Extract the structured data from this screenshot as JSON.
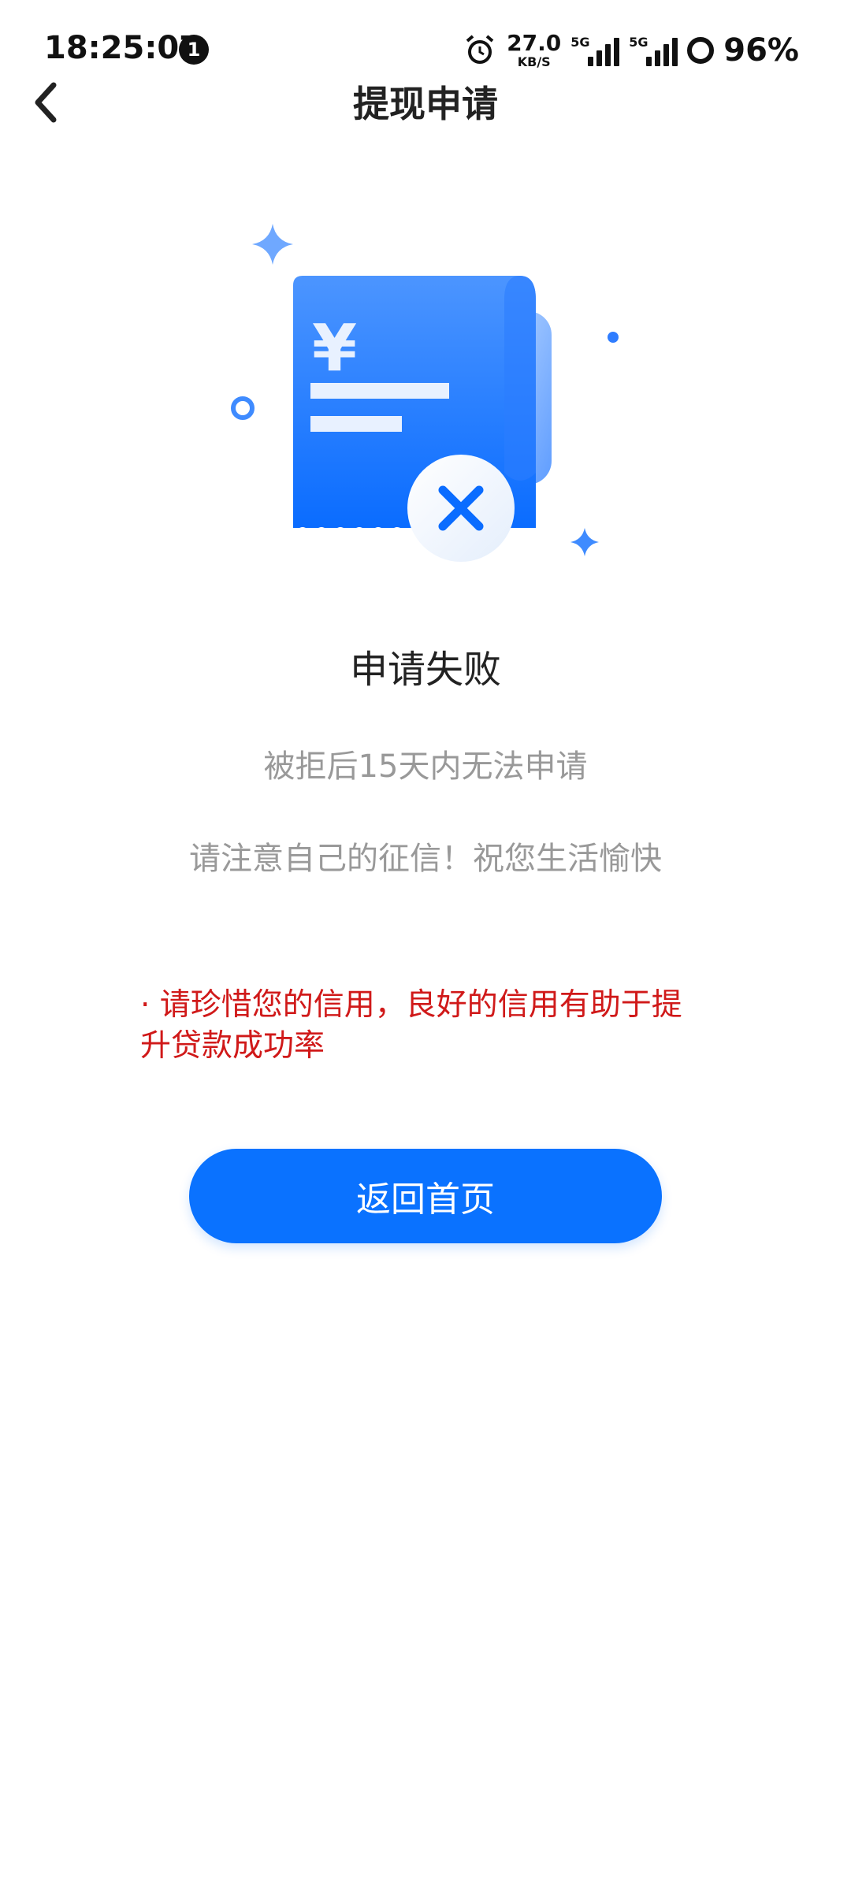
{
  "status_bar": {
    "time": "18:25:07",
    "notification_count": "1",
    "net_speed_value": "27.0",
    "net_speed_unit": "KB/S",
    "signal1_tag": "5G",
    "signal2_tag": "5G",
    "battery": "96%"
  },
  "header": {
    "title": "提现申请",
    "back_icon": "chevron-left-icon"
  },
  "result": {
    "title": "申请失败",
    "line1": "被拒后15天内无法申请",
    "line2": "请注意自己的征信！祝您生活愉快",
    "warning": "· 请珍惜您的信用，良好的信用有助于提升贷款成功率"
  },
  "actions": {
    "home_button_label": "返回首页"
  },
  "illustration": {
    "icon": "receipt-failed-icon",
    "currency_symbol": "¥"
  },
  "colors": {
    "accent": "#0a72ff",
    "warning": "#d01919",
    "muted_text": "#999999"
  }
}
